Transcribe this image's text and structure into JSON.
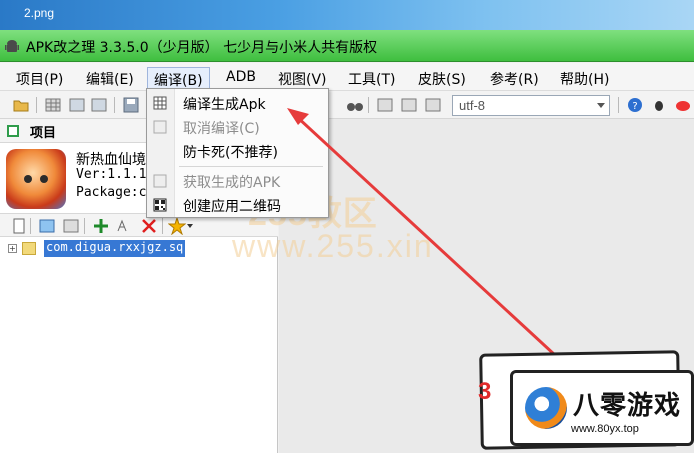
{
  "desktop": {
    "filename": "2.png"
  },
  "window": {
    "title": "APK改之理 3.3.5.0（少月版） 七少月与小米人共有版权"
  },
  "menubar": {
    "items": [
      {
        "label": "项目(P)"
      },
      {
        "label": "编辑(E)"
      },
      {
        "label": "编译(B)"
      },
      {
        "label": "ADB"
      },
      {
        "label": "视图(V)"
      },
      {
        "label": "工具(T)"
      },
      {
        "label": "皮肤(S)"
      },
      {
        "label": "参考(R)"
      },
      {
        "label": "帮助(H)"
      }
    ]
  },
  "toolbar": {
    "encoding": "utf-8"
  },
  "project_panel": {
    "title": "项目",
    "app_name": "新热血仙境",
    "version": "Ver:1.1.1",
    "package_label": "Package:c"
  },
  "tree": {
    "root_label": "com.digua.rxxjgz.sq"
  },
  "build_menu": {
    "items": [
      {
        "label": "编译生成Apk",
        "enabled": true,
        "icon": "build-icon"
      },
      {
        "label": "取消编译(C)",
        "enabled": false,
        "icon": "cancel-build-icon"
      },
      {
        "label": "防卡死(不推荐)",
        "enabled": true,
        "icon": ""
      },
      {
        "label": "获取生成的APK",
        "enabled": false,
        "icon": "get-apk-icon"
      },
      {
        "label": "创建应用二维码",
        "enabled": true,
        "icon": "qrcode-icon"
      }
    ]
  },
  "watermark": {
    "line1": "255教区",
    "line2": "www.255.xin"
  },
  "logo": {
    "number": "3",
    "name": "八零游戏",
    "url": "www.80yx.top"
  },
  "colors": {
    "titlebar": "#3fbe3f",
    "selection": "#3778d4",
    "arrow": "#e63b3b"
  }
}
